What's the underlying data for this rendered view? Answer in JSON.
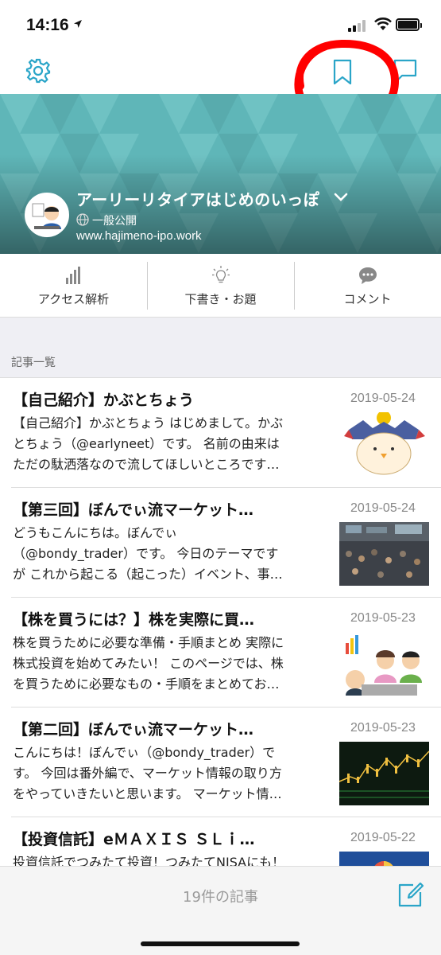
{
  "status_bar": {
    "time": "14:16"
  },
  "nav": {
    "settings_icon": "gear-icon",
    "bookmark_icon": "bookmark-icon",
    "comment_icon": "speech-bubble-icon",
    "annotation_color": "#ff0000"
  },
  "blog": {
    "title": "アーリーリタイアはじめのいっぽ",
    "visibility": "一般公開",
    "url": "www.hajimeno-ipo.work"
  },
  "tabs": [
    {
      "label": "アクセス解析",
      "icon": "bar-chart-icon"
    },
    {
      "label": "下書き・お題",
      "icon": "lightbulb-icon"
    },
    {
      "label": "コメント",
      "icon": "comment-icon"
    }
  ],
  "section_title": "記事一覧",
  "articles": [
    {
      "title": "【自己紹介】かぶとちょう",
      "date": "2019-05-24",
      "excerpt": [
        "【自己紹介】かぶとちょう はじめまして。かぶ",
        "とちょう（@earlyneet）です。 名前の由来は",
        "ただの駄洒落なので流してほしいところです…"
      ]
    },
    {
      "title": "【第三回】ぼんでぃ流マーケット…",
      "date": "2019-05-24",
      "excerpt": [
        "どうもこんにちは。ぼんでぃ",
        "（@bondy_trader）です。 今日のテーマです",
        "が これから起こる（起こった）イベント、事…"
      ]
    },
    {
      "title": "【株を買うには？】株を実際に買…",
      "date": "2019-05-23",
      "excerpt": [
        "株を買うために必要な準備・手順まとめ 実際に",
        "株式投資を始めてみたい！ このページでは、株",
        "を買うために必要なもの・手順をまとめてお…"
      ]
    },
    {
      "title": "【第二回】ぼんでぃ流マーケット…",
      "date": "2019-05-23",
      "excerpt": [
        "こんにちは！ぼんでぃ（@bondy_trader）で",
        "す。 今回は番外編で、マーケット情報の取り方",
        "をやっていきたいと思います。 マーケット情…"
      ]
    },
    {
      "title": "【投資信託】eＭＡＸＩＳ ＳＬｉ…",
      "date": "2019-05-22",
      "excerpt": [
        "投資信託でつみたて投資！つみたてNISAにも！"
      ]
    }
  ],
  "footer": {
    "count_label": "19件の記事",
    "compose_icon": "compose-icon"
  },
  "colors": {
    "accent": "#2aa5c8",
    "hero": "#5fb6b8"
  }
}
